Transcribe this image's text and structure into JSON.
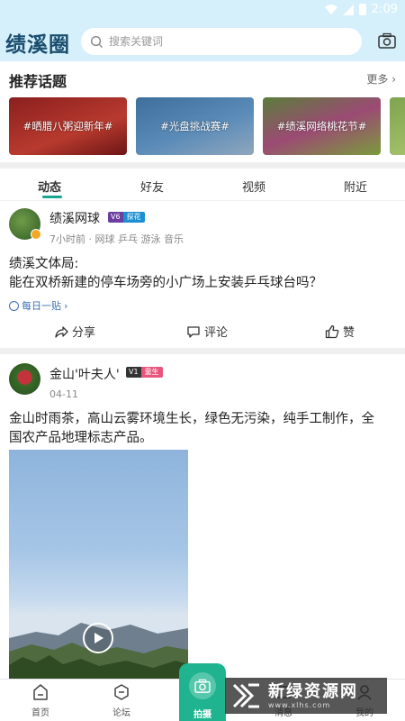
{
  "status_bar": {
    "time": "2:09"
  },
  "header": {
    "logo_text": "绩溪圈",
    "search_placeholder": "搜索关键词",
    "icons": [
      "search-icon",
      "camera-icon"
    ]
  },
  "topics": {
    "title": "推荐话题",
    "more_label": "更多",
    "cards": [
      {
        "label": "#晒腊八粥迎新年#"
      },
      {
        "label": "#光盘挑战赛#"
      },
      {
        "label": "#绩溪网络桃花节#"
      }
    ]
  },
  "tabs": [
    {
      "label": "动态",
      "active": true
    },
    {
      "label": "好友",
      "active": false
    },
    {
      "label": "视频",
      "active": false
    },
    {
      "label": "附近",
      "active": false
    }
  ],
  "posts": [
    {
      "author": "绩溪网球",
      "level": "V6",
      "level_title": "探花",
      "meta": "7小时前 · 网球  乒乓  游泳  音乐",
      "text_line1": "绩溪文体局:",
      "text_line2": "能在双桥新建的停车场旁的小广场上安装乒乓球台吗？",
      "tag": "每日一贴",
      "actions": {
        "share": "分享",
        "comment": "评论",
        "like": "赞"
      }
    },
    {
      "author": "金山'叶夫人'",
      "level": "V1",
      "level_title": "童生",
      "date": "04-11",
      "text_line1": "金山时雨茶，高山云雾环境生长，绿色无污染，纯手工制作，全",
      "text_line2": "国农产品地理标志产品。"
    }
  ],
  "bottom_nav": {
    "items": [
      {
        "label": "首页",
        "icon": "home-icon"
      },
      {
        "label": "论坛",
        "icon": "forum-icon"
      },
      {
        "label": "拍摄",
        "icon": "camera-icon"
      },
      {
        "label": "消息",
        "icon": "message-icon"
      },
      {
        "label": "我的",
        "icon": "profile-icon"
      }
    ]
  },
  "watermark": {
    "title": "新绿资源网",
    "url": "www.xlhs.com"
  },
  "colors": {
    "accent": "#1fb48f",
    "header_bg": "#d5f0fb",
    "link": "#3d6fb4"
  }
}
